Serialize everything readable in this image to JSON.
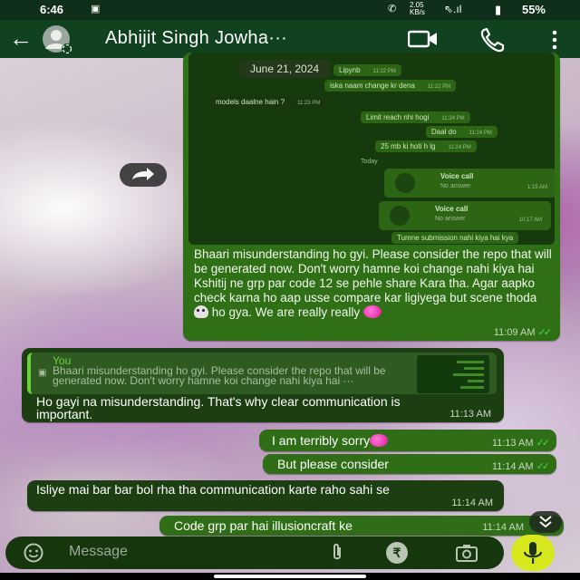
{
  "status_bar": {
    "time": "6:46",
    "speed_top": "2.05",
    "speed_unit": "KB/s",
    "battery": "55%"
  },
  "header": {
    "contact_name": "Abhijit Singh Jowha···"
  },
  "forwarded_image": {
    "date": "June 21, 2024",
    "rows": [
      {
        "text": "Lipynb",
        "time": "11:22 PM",
        "out": true
      },
      {
        "text": "iska naam change kr dena",
        "time": "11:22 PM",
        "out": true
      },
      {
        "text": "models daalne hain ?",
        "time": "11:23 PM",
        "out": false
      },
      {
        "text": "Limit reach nhi hogi",
        "time": "11:24 PM",
        "out": true
      },
      {
        "text": "Daal do",
        "time": "11:24 PM",
        "out": true
      },
      {
        "text": "25 mb ki hoti h lg",
        "time": "11:24 PM",
        "out": true
      }
    ],
    "today": "Today",
    "calls": [
      {
        "title": "Voice call",
        "sub": "No answer",
        "time": "1:15 AM"
      },
      {
        "title": "Voice call",
        "sub": "No answer",
        "time": "10:17 AM"
      }
    ],
    "last_row": "Tumne submission nahi kiya hai kya"
  },
  "messages": {
    "m1": {
      "text": "Bhaari misunderstanding ho gyi. Please consider the repo that will be generated now. Don't worry hamne koi change nahi kiya hai Kshitij ne grp par code 12 se pehle share Kara tha. Agar aapko check karna ho aap usse compare kar ligiyega but scene thoda",
      "text2": "ho gya. We are really really",
      "time": "11:09 AM"
    },
    "m2": {
      "quote_author": "You",
      "quote_text": "Bhaari misunderstanding ho gyi. Please consider the repo that will be generated now. Don't worry hamne koi change nahi kiya hai ···",
      "text": "Ho gayi na misunderstanding. That's why clear communication is important.",
      "time": "11:13 AM"
    },
    "m3": {
      "text": "I am terribly sorry",
      "time": "11:13 AM"
    },
    "m4": {
      "text": "But please consider",
      "time": "11:14 AM"
    },
    "m5": {
      "text": "Isliye mai bar bar bol rha tha communication karte raho sahi se",
      "time": "11:14 AM"
    },
    "m6": {
      "text": "Code grp par hai illusioncraft ke",
      "time": "11:14 AM"
    }
  },
  "composer": {
    "placeholder": "Message"
  },
  "icons": [
    "back-arrow-icon",
    "avatar",
    "video-call-icon",
    "voice-call-icon",
    "more-options-icon",
    "forward-icon",
    "emoji-icon",
    "attach-icon",
    "rupee-icon",
    "camera-icon",
    "mic-icon",
    "scroll-down-icon"
  ],
  "colors": {
    "header": "#11421f",
    "outgoing": "#2f6e16",
    "incoming": "#1c3e12",
    "ticks": "#47d84a",
    "mic_button": "#d8e81e"
  }
}
